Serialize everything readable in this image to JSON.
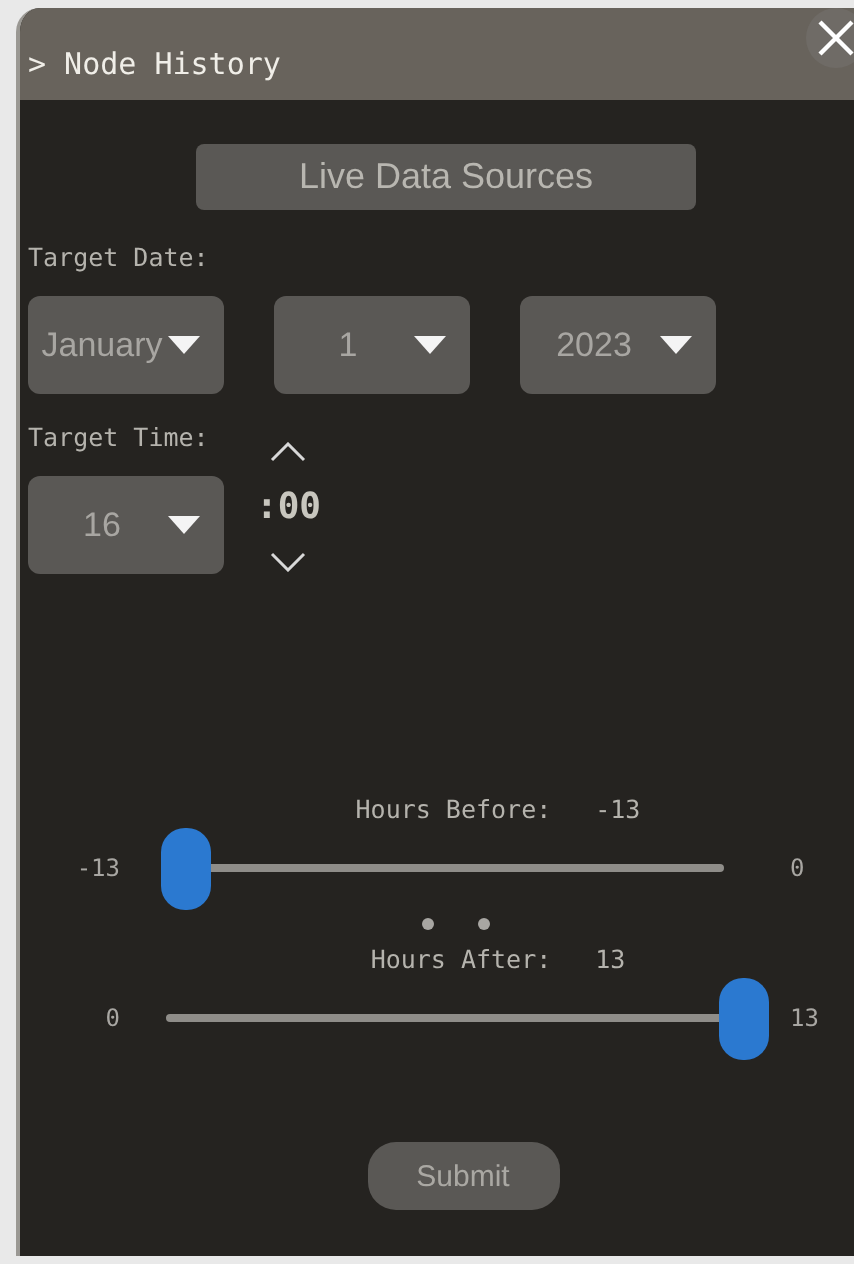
{
  "window": {
    "title": "> Node History"
  },
  "source_button": {
    "label": "Live Data Sources"
  },
  "date": {
    "label": "Target Date:",
    "selects": [
      {
        "value": "January"
      },
      {
        "value": "1"
      },
      {
        "value": "2023"
      }
    ]
  },
  "time": {
    "label": "Target Time:",
    "hour": "16",
    "minutes": ":00"
  },
  "sliders": [
    {
      "label": "Hours Before:",
      "reading": "-13",
      "min": "-13",
      "max": "0",
      "level": 0
    },
    {
      "label": "Hours After:",
      "reading": "13",
      "min": "0",
      "max": "13",
      "level": 1
    }
  ],
  "submit": {
    "label": "Submit"
  }
}
